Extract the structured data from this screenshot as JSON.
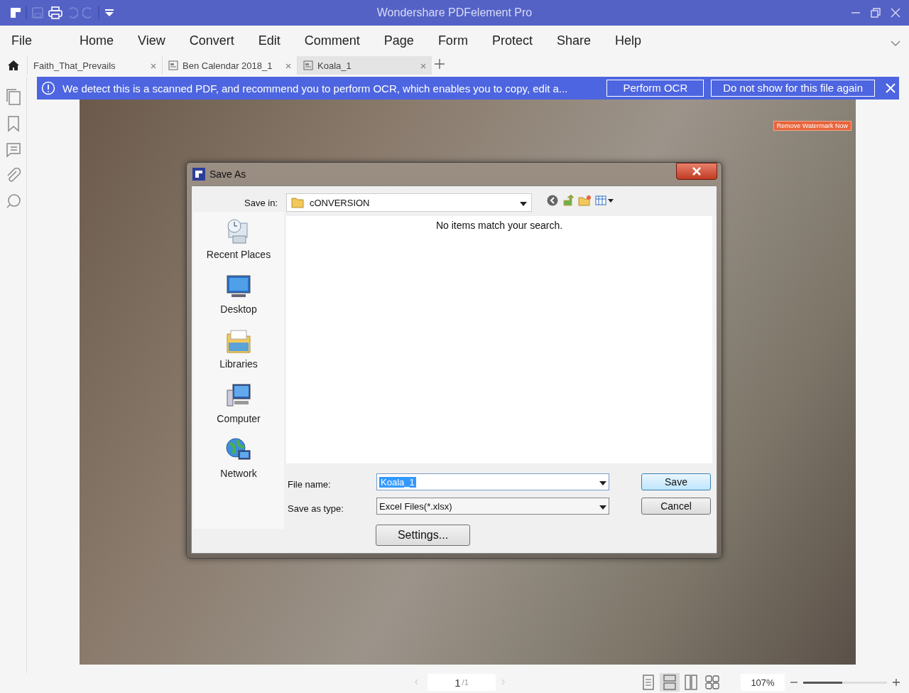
{
  "window": {
    "title": "Wondershare PDFelement Pro"
  },
  "menu": [
    "File",
    "Home",
    "View",
    "Convert",
    "Edit",
    "Comment",
    "Page",
    "Form",
    "Protect",
    "Share",
    "Help"
  ],
  "tabs": [
    {
      "label": "Faith_That_Prevails",
      "selected": false,
      "has_icon": false
    },
    {
      "label": "Ben Calendar 2018_1",
      "selected": false,
      "has_icon": true
    },
    {
      "label": "Koala_1",
      "selected": true,
      "has_icon": true
    }
  ],
  "ocr_bar": {
    "message": "We detect this is a scanned PDF, and recommend you to perform OCR, which enables you to copy, edit a...",
    "buttons": [
      "Perform OCR",
      "Do not show for this file again"
    ]
  },
  "document": {
    "watermark_button": "Remove Watermark Now"
  },
  "dialog": {
    "title": "Save As",
    "save_in_label": "Save in:",
    "save_in_value": "cONVERSION",
    "empty_message": "No items match your search.",
    "places": [
      {
        "label": "Recent Places",
        "kind": "recent"
      },
      {
        "label": "Desktop",
        "kind": "desktop"
      },
      {
        "label": "Libraries",
        "kind": "libraries"
      },
      {
        "label": "Computer",
        "kind": "computer"
      },
      {
        "label": "Network",
        "kind": "network"
      }
    ],
    "file_name_label": "File name:",
    "file_name_value": "Koala_1",
    "save_type_label": "Save as type:",
    "save_type_value": "Excel Files(*.xlsx)",
    "buttons": [
      "Save",
      "Cancel"
    ],
    "settings_button": "Settings..."
  },
  "status_bar": {
    "page_current": "1",
    "page_total": "/1",
    "view_modes": [
      {
        "selected": false
      },
      {
        "selected": true
      },
      {
        "selected": false
      },
      {
        "selected": false
      }
    ],
    "zoom": "107%",
    "zoom_slider": {
      "level": 0.47
    }
  }
}
